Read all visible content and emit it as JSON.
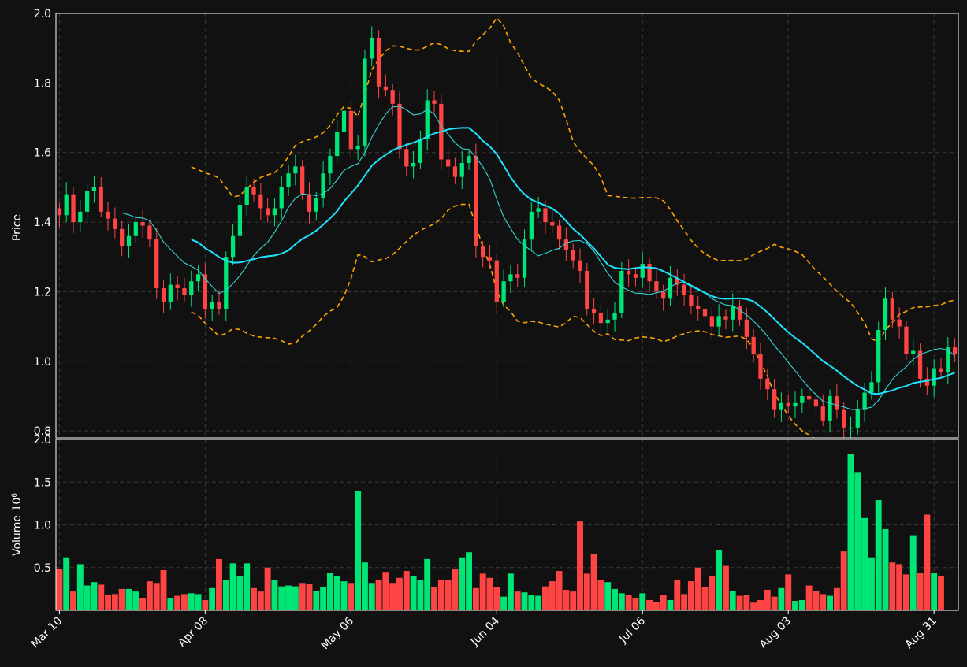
{
  "colors": {
    "background": "#111111",
    "up": "#00e676",
    "down": "#ff4444",
    "sma_fast": "#35d4d4",
    "sma_slow": "#1ee3ff",
    "bands": "#ffa500",
    "grid": "#3a3a3a",
    "text": "#ffffff"
  },
  "chart_data": {
    "type": "candlestick",
    "price_axis": {
      "label": "Price",
      "ylim": [
        0.78,
        2.0
      ],
      "ticks": [
        "0.8",
        "1.0",
        "1.2",
        "1.4",
        "1.6",
        "1.8",
        "2.0"
      ]
    },
    "volume_axis": {
      "label": "Volume  10",
      "label_exponent": "6",
      "ylim": [
        0,
        2.0
      ],
      "ticks": [
        "0.5",
        "1.0",
        "1.5",
        "2.0"
      ]
    },
    "x_axis": {
      "tick_labels": [
        "Mar 10",
        "Apr 08",
        "May 06",
        "Jun 04",
        "Jul 06",
        "Aug 03",
        "Aug 31"
      ],
      "tick_indices": [
        0,
        21,
        42,
        63,
        84,
        105,
        126
      ]
    },
    "grid": true,
    "dates": [
      "Mar 10",
      "Mar 11",
      "Mar 12",
      "Mar 13",
      "Mar 14",
      "Mar 17",
      "Mar 18",
      "Mar 19",
      "Mar 20",
      "Mar 21",
      "Mar 24",
      "Mar 25",
      "Mar 26",
      "Mar 27",
      "Mar 28",
      "Mar 31",
      "Apr 01",
      "Apr 02",
      "Apr 03",
      "Apr 04",
      "Apr 07",
      "Apr 08",
      "Apr 09",
      "Apr 10",
      "Apr 11",
      "Apr 14",
      "Apr 15",
      "Apr 16",
      "Apr 17",
      "Apr 18",
      "Apr 21",
      "Apr 22",
      "Apr 23",
      "Apr 24",
      "Apr 25",
      "Apr 28",
      "Apr 29",
      "Apr 30",
      "May 01",
      "May 02",
      "May 05",
      "May 06",
      "May 07",
      "May 08",
      "May 09",
      "May 12",
      "May 13",
      "May 14",
      "May 15",
      "May 16",
      "May 19",
      "May 20",
      "May 21",
      "May 22",
      "May 23",
      "May 26",
      "May 27",
      "May 28",
      "May 29",
      "May 30",
      "Jun 02",
      "Jun 03",
      "Jun 04",
      "Jun 05",
      "Jun 06",
      "Jun 09",
      "Jun 10",
      "Jun 11",
      "Jun 12",
      "Jun 13",
      "Jun 16",
      "Jun 17",
      "Jun 18",
      "Jun 19",
      "Jun 20",
      "Jun 23",
      "Jun 24",
      "Jun 25",
      "Jun 26",
      "Jun 27",
      "Jun 30",
      "Jul 01",
      "Jul 02",
      "Jul 03",
      "Jul 06",
      "Jul 07",
      "Jul 08",
      "Jul 09",
      "Jul 10",
      "Jul 13",
      "Jul 14",
      "Jul 15",
      "Jul 16",
      "Jul 17",
      "Jul 20",
      "Jul 21",
      "Jul 22",
      "Jul 23",
      "Jul 24",
      "Jul 27",
      "Jul 28",
      "Jul 29",
      "Jul 30",
      "Jul 31",
      "Aug 01",
      "Aug 03",
      "Aug 04",
      "Aug 05",
      "Aug 06",
      "Aug 07",
      "Aug 10",
      "Aug 11",
      "Aug 12",
      "Aug 13",
      "Aug 14",
      "Aug 17",
      "Aug 18",
      "Aug 19",
      "Aug 20",
      "Aug 21",
      "Aug 24",
      "Aug 25",
      "Aug 26",
      "Aug 27",
      "Aug 28",
      "Aug 31",
      "Sep 01",
      "Sep 02",
      "Sep 03",
      "Sep 04"
    ],
    "close": [
      1.42,
      1.48,
      1.4,
      1.43,
      1.49,
      1.5,
      1.43,
      1.41,
      1.38,
      1.33,
      1.36,
      1.4,
      1.39,
      1.35,
      1.21,
      1.17,
      1.22,
      1.21,
      1.19,
      1.23,
      1.25,
      1.15,
      1.17,
      1.15,
      1.3,
      1.36,
      1.45,
      1.5,
      1.48,
      1.44,
      1.42,
      1.44,
      1.5,
      1.54,
      1.56,
      1.48,
      1.43,
      1.47,
      1.54,
      1.59,
      1.66,
      1.72,
      1.61,
      1.62,
      1.87,
      1.93,
      1.79,
      1.78,
      1.74,
      1.61,
      1.56,
      1.57,
      1.64,
      1.75,
      1.74,
      1.58,
      1.56,
      1.53,
      1.57,
      1.59,
      1.33,
      1.3,
      1.29,
      1.17,
      1.23,
      1.25,
      1.24,
      1.35,
      1.43,
      1.44,
      1.4,
      1.39,
      1.35,
      1.32,
      1.29,
      1.26,
      1.15,
      1.14,
      1.11,
      1.12,
      1.14,
      1.26,
      1.25,
      1.24,
      1.28,
      1.23,
      1.2,
      1.18,
      1.24,
      1.22,
      1.19,
      1.16,
      1.15,
      1.13,
      1.1,
      1.13,
      1.12,
      1.16,
      1.12,
      1.07,
      1.02,
      0.95,
      0.92,
      0.86,
      0.88,
      0.87,
      0.88,
      0.9,
      0.89,
      0.87,
      0.83,
      0.9,
      0.86,
      0.81,
      0.81,
      0.86,
      0.91,
      0.94,
      1.09,
      1.18,
      1.12,
      1.1,
      1.02,
      1.03,
      0.95,
      0.93,
      0.98,
      0.97,
      1.04,
      1.02
    ],
    "candles_note": "OHLC estimated from chart",
    "volume": [
      0.48,
      0.62,
      0.22,
      0.54,
      0.29,
      0.33,
      0.3,
      0.18,
      0.19,
      0.25,
      0.25,
      0.22,
      0.14,
      0.34,
      0.32,
      0.47,
      0.14,
      0.17,
      0.19,
      0.2,
      0.19,
      0.12,
      0.26,
      0.6,
      0.35,
      0.55,
      0.4,
      0.55,
      0.26,
      0.22,
      0.5,
      0.35,
      0.28,
      0.29,
      0.28,
      0.32,
      0.31,
      0.23,
      0.27,
      0.44,
      0.4,
      0.34,
      0.32,
      1.4,
      0.56,
      0.32,
      0.36,
      0.45,
      0.32,
      0.38,
      0.46,
      0.4,
      0.35,
      0.6,
      0.27,
      0.36,
      0.36,
      0.48,
      0.62,
      0.68,
      0.26,
      0.43,
      0.38,
      0.27,
      0.16,
      0.43,
      0.22,
      0.21,
      0.18,
      0.17,
      0.28,
      0.34,
      0.46,
      0.24,
      0.22,
      1.04,
      0.43,
      0.66,
      0.35,
      0.33,
      0.25,
      0.2,
      0.18,
      0.14,
      0.2,
      0.12,
      0.1,
      0.18,
      0.12,
      0.36,
      0.19,
      0.34,
      0.5,
      0.27,
      0.4,
      0.71,
      0.52,
      0.23,
      0.17,
      0.18,
      0.09,
      0.12,
      0.24,
      0.16,
      0.26,
      0.42,
      0.11,
      0.12,
      0.29,
      0.23,
      0.19,
      0.17,
      0.26,
      0.69,
      1.83,
      1.61,
      1.08,
      0.62,
      1.29,
      0.95,
      0.56,
      0.54,
      0.42,
      0.87,
      0.44,
      1.12,
      0.44,
      0.4
    ]
  }
}
